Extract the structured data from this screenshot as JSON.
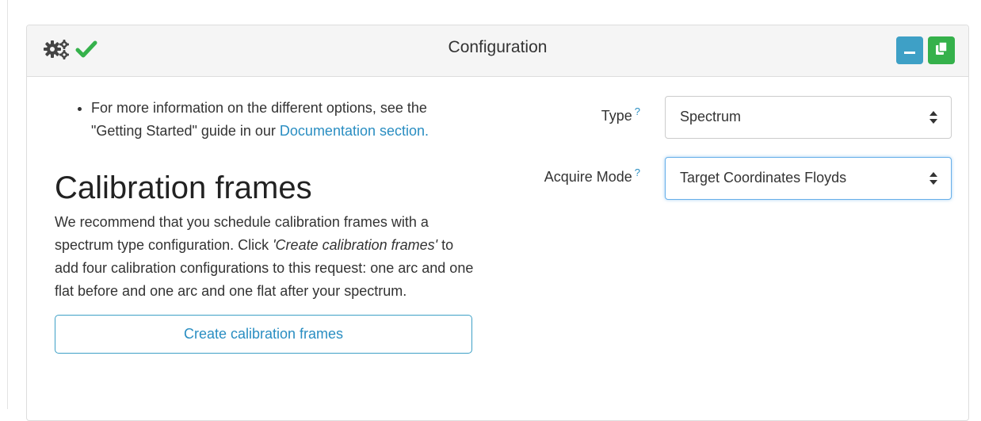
{
  "panel": {
    "title": "Configuration",
    "icons": {
      "settings": "gears-icon",
      "status": "check-icon"
    },
    "buttons": {
      "minimize": "minimize-icon",
      "copy": "copy-icon"
    },
    "colors": {
      "info": "#3ea0c6",
      "success": "#35b14b",
      "check": "#35b14b",
      "link": "#2a8ec2"
    }
  },
  "info": {
    "bullet_text": "For more information on the different options, see the \"Getting Started\" guide in our ",
    "doc_link": "Documentation section."
  },
  "calibration": {
    "heading": "Calibration frames",
    "para_1": "We recommend that you schedule calibration frames with a spectrum type configuration. Click ",
    "para_em": "'Create calibration frames'",
    "para_2": " to add four calibration configurations to this request: one arc and one flat before and one arc and one flat after your spectrum.",
    "button": "Create calibration frames"
  },
  "form": {
    "help_mark": "?",
    "type": {
      "label": "Type",
      "value": "Spectrum"
    },
    "acquire_mode": {
      "label": "Acquire Mode",
      "value": "Target Coordinates Floyds"
    }
  }
}
